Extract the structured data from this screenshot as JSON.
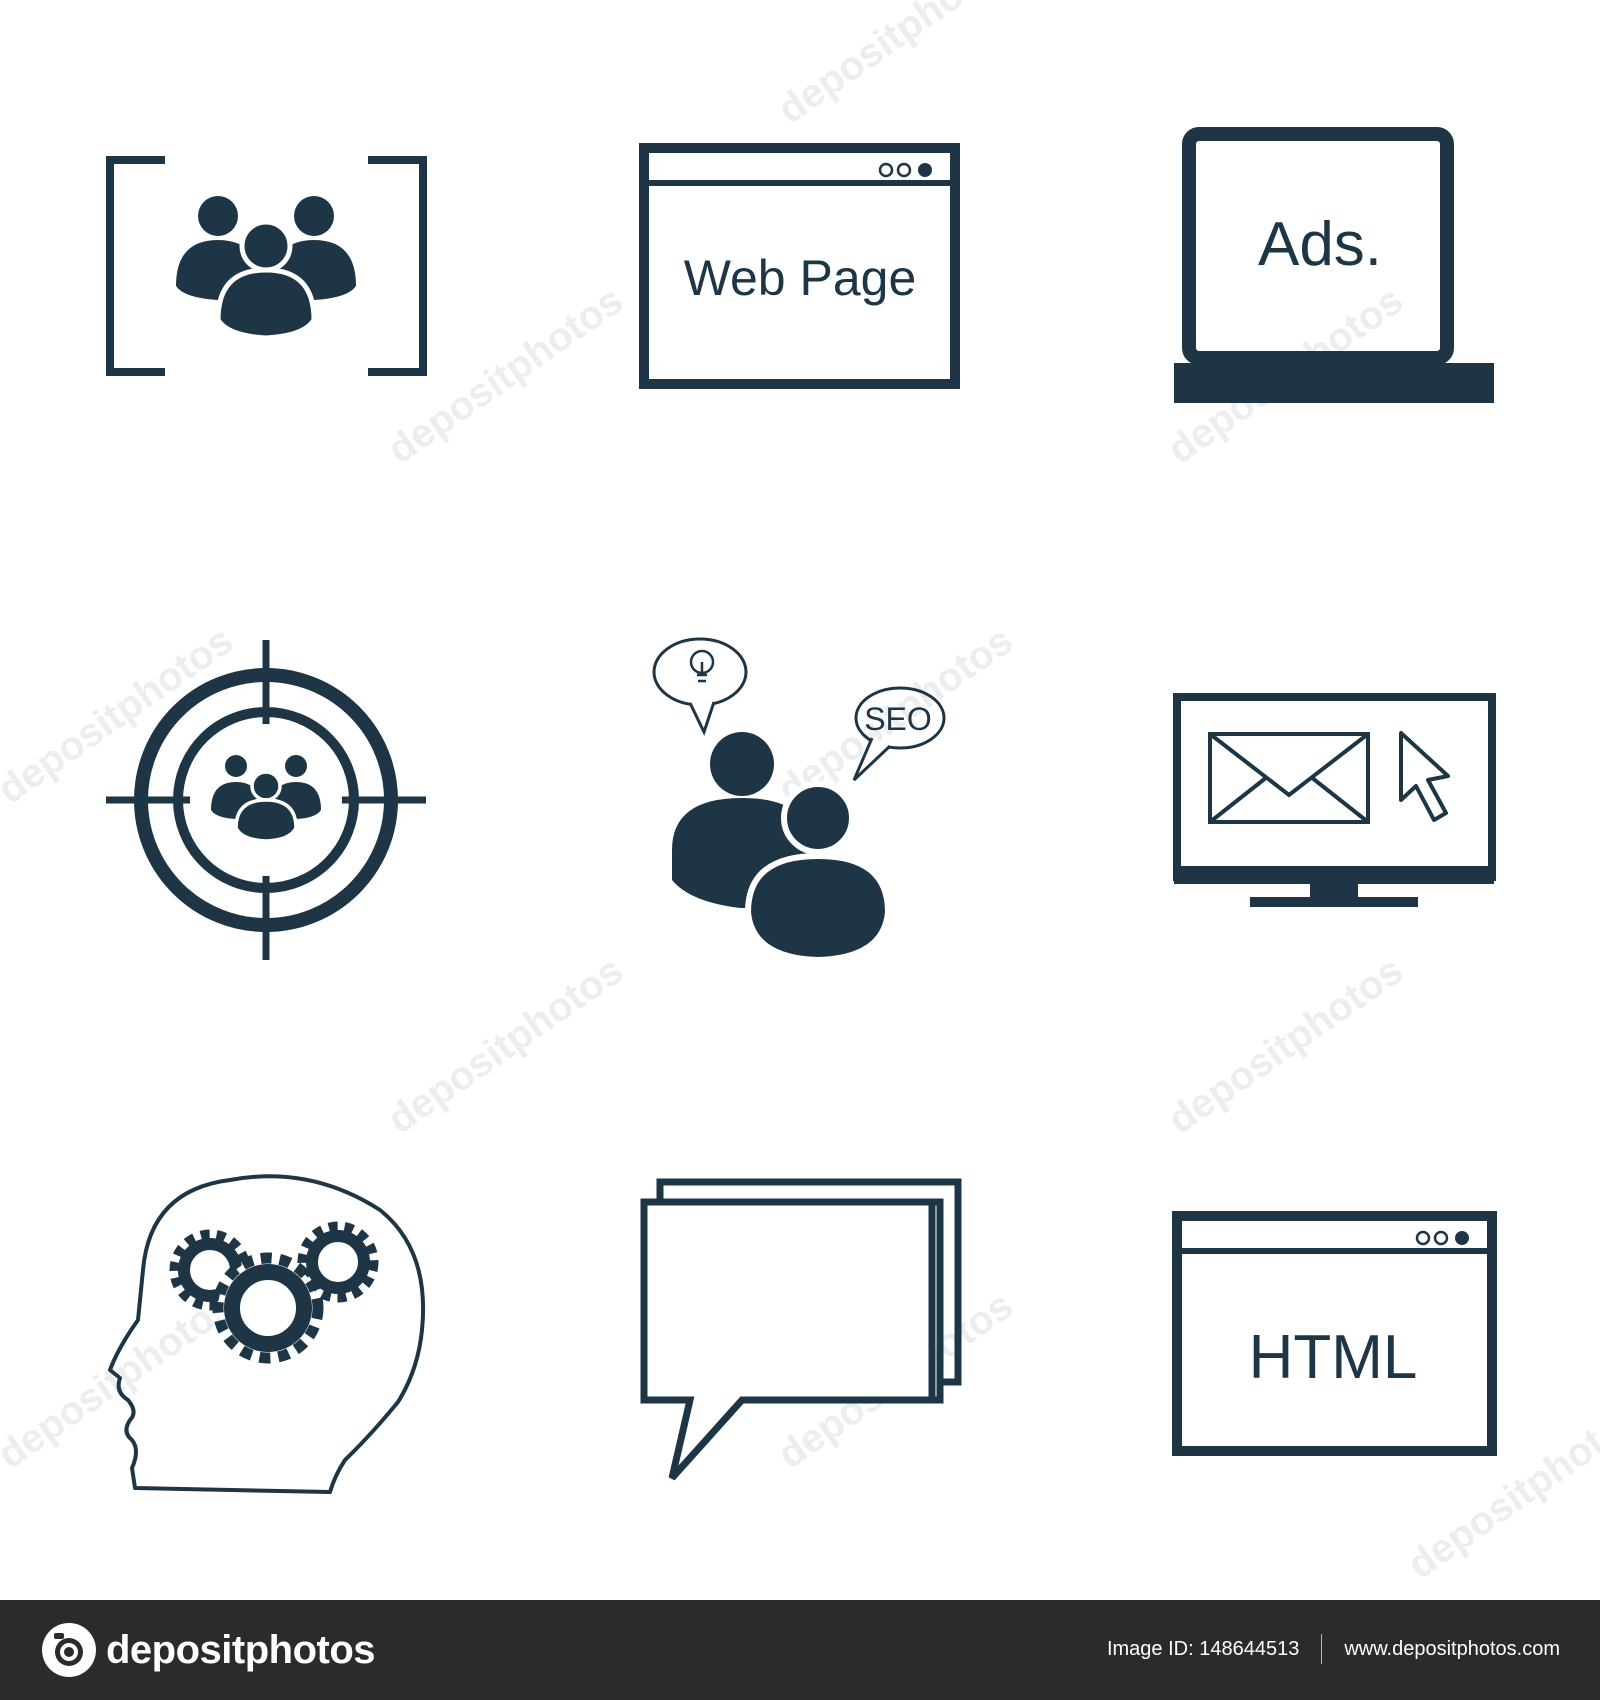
{
  "colors": {
    "icon": "#1e3545",
    "background": "#ffffff",
    "footer_bg": "#2b2b2b",
    "watermark": "#dfe2e5"
  },
  "icons": [
    {
      "name": "focus-group-icon",
      "label": ""
    },
    {
      "name": "web-page-icon",
      "label": "Web Page"
    },
    {
      "name": "laptop-ads-icon",
      "label": "Ads."
    },
    {
      "name": "target-audience-icon",
      "label": ""
    },
    {
      "name": "seo-consulting-icon",
      "label": "SEO"
    },
    {
      "name": "email-marketing-icon",
      "label": ""
    },
    {
      "name": "brainstorming-head-gears-icon",
      "label": ""
    },
    {
      "name": "chat-bubbles-icon",
      "label": ""
    },
    {
      "name": "html-window-icon",
      "label": "HTML"
    }
  ],
  "watermark": {
    "text": "depositphotos"
  },
  "footer": {
    "brand": "depositphotos",
    "image_id_label": "Image ID:",
    "image_id_value": "148644513",
    "website": "www.depositphotos.com"
  }
}
